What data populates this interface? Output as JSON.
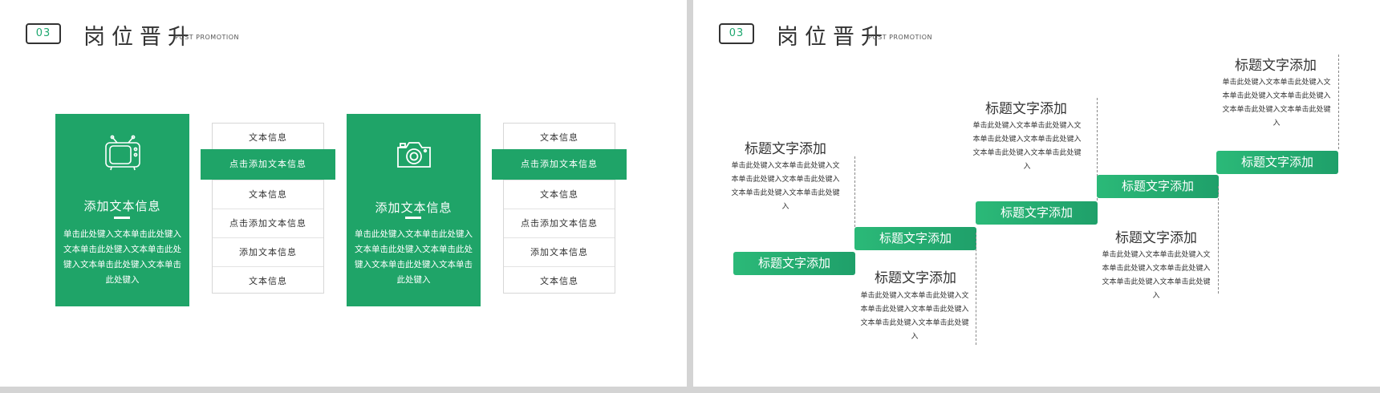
{
  "header": {
    "badge": "03",
    "title": "岗位晋升",
    "subtitle": "POST PROMOTION"
  },
  "left": {
    "cards": [
      {
        "icon": "tv-icon",
        "title": "添加文本信息",
        "desc": "单击此处键入文本单击此处键入文本单击此处键入文本单击此处键入文本单击此处键入文本单击此处键入"
      },
      {
        "icon": "camera-icon",
        "title": "添加文本信息",
        "desc": "单击此处键入文本单击此处键入文本单击此处键入文本单击此处键入文本单击此处键入文本单击此处键入"
      }
    ],
    "lists": [
      {
        "rows": [
          "文本信息",
          "点击添加文本信息",
          "文本信息",
          "点击添加文本信息",
          "添加文本信息",
          "文本信息"
        ],
        "highlight_index": 1
      },
      {
        "rows": [
          "文本信息",
          "点击添加文本信息",
          "文本信息",
          "点击添加文本信息",
          "添加文本信息",
          "文本信息"
        ],
        "highlight_index": 1
      }
    ]
  },
  "right": {
    "steps": [
      {
        "button": "标题文字添加",
        "title": "标题文字添加",
        "desc": "单击此处键入文本单击此处键入文本单击此处键入文本单击此处键入文本单击此处键入文本单击此处键入"
      },
      {
        "button": "标题文字添加",
        "title": "标题文字添加",
        "desc": "单击此处键入文本单击此处键入文本单击此处键入文本单击此处键入文本单击此处键入文本单击此处键入"
      },
      {
        "button": "标题文字添加",
        "title": "标题文字添加",
        "desc": "单击此处键入文本单击此处键入文本单击此处键入文本单击此处键入文本单击此处键入文本单击此处键入"
      },
      {
        "button": "标题文字添加",
        "title": "标题文字添加",
        "desc": "单击此处键入文本单击此处键入文本单击此处键入文本单击此处键入文本单击此处键入文本单击此处键入"
      },
      {
        "button": "标题文字添加",
        "title": "标题文字添加",
        "desc": "单击此处键入文本单击此处键入文本单击此处键入文本单击此处键入文本单击此处键入文本单击此处键入"
      }
    ]
  },
  "colors": {
    "accent": "#1fa468",
    "text": "#333333",
    "background": "#ffffff",
    "frame": "#d4d4d4"
  }
}
